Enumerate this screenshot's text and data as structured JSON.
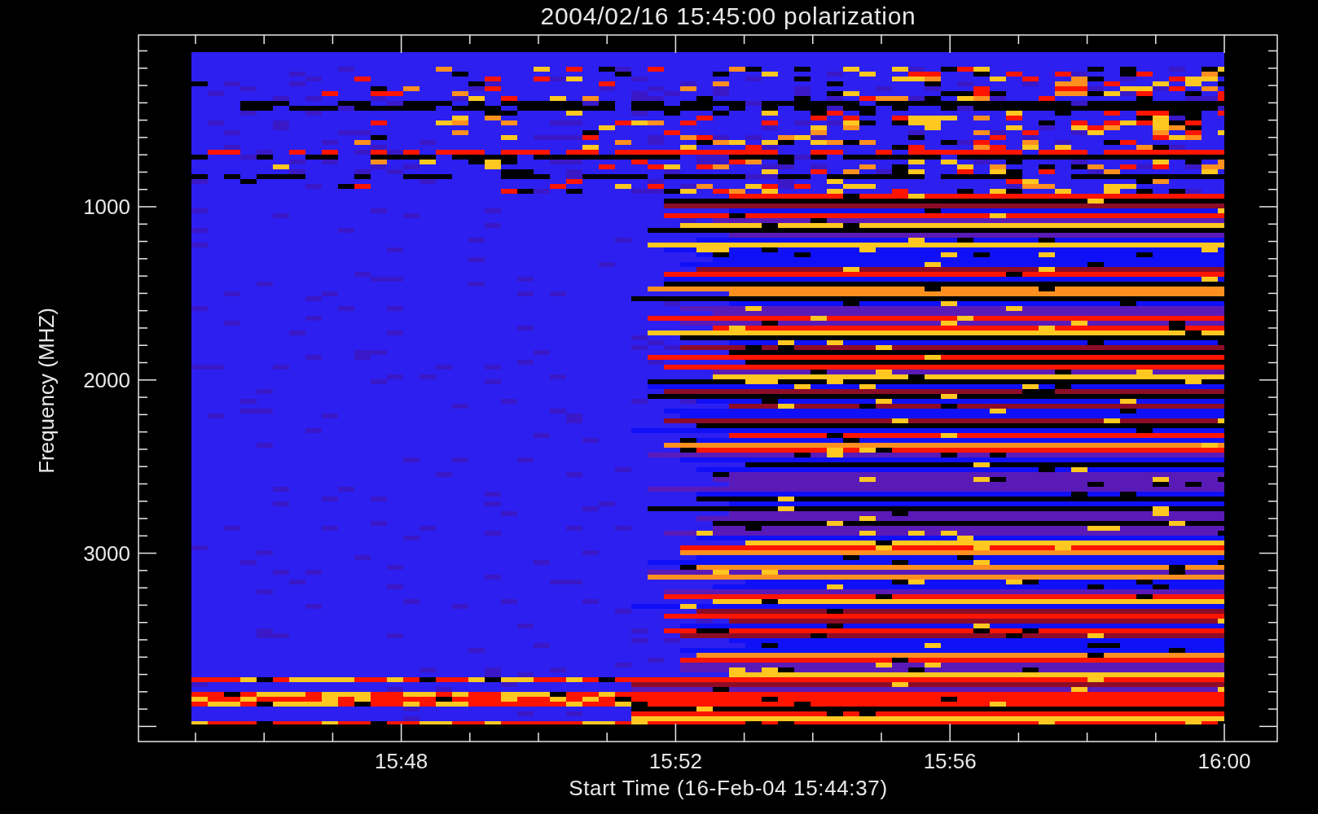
{
  "title": "2004/02/16 15:45:00 polarization",
  "y_axis": {
    "label": "Frequency (MHZ)",
    "ticks": [
      "1000",
      "2000",
      "3000"
    ]
  },
  "x_axis": {
    "label": "Start Time (16-Feb-04 15:44:37)",
    "ticks": [
      "15:48",
      "15:52",
      "15:56",
      "16:00"
    ]
  }
}
